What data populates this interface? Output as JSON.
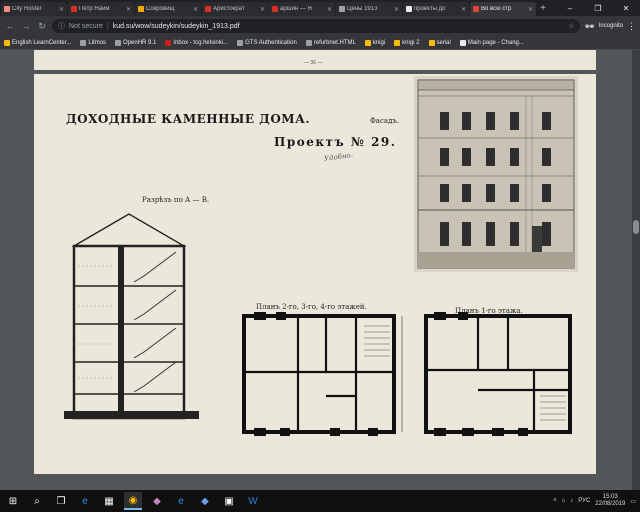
{
  "browser": {
    "tabs": [
      {
        "title": "City Roster",
        "color": "#f28b82",
        "active": false
      },
      {
        "title": "Пётр Наим",
        "color": "#d93025",
        "active": false
      },
      {
        "title": "Сокровищ",
        "color": "#f9ab00",
        "active": false
      },
      {
        "title": "Аристократ",
        "color": "#d93025",
        "active": false
      },
      {
        "title": "аршин — Я",
        "color": "#d93025",
        "active": false
      },
      {
        "title": "Цены 1913",
        "color": "#a0a0a0",
        "active": false
      },
      {
        "title": "проекты до",
        "color": "#e8eaed",
        "active": false
      },
      {
        "title": "Во всю стр",
        "color": "#ea4335",
        "active": true
      }
    ],
    "new_tab": "+",
    "window_controls": {
      "minimize": "–",
      "maximize": "❐",
      "close": "✕"
    },
    "nav": {
      "back": "←",
      "forward": "→",
      "reload": "↻"
    },
    "security_text": "Not secure",
    "url": "kud.su/wow/sudeykin/sudeykin_1913.pdf",
    "incognito_label": "Incognito",
    "star": "☆"
  },
  "bookmarks": [
    {
      "label": "English LearnCenter...",
      "color": "#fbbc04"
    },
    {
      "label": "Litmos",
      "color": "#9aa0a6"
    },
    {
      "label": "OpenHR 9.1",
      "color": "#9aa0a6"
    },
    {
      "label": "Inbox - tcg.helsinki...",
      "color": "#c5221f"
    },
    {
      "label": "GTS Authentication",
      "color": "#9aa0a6"
    },
    {
      "label": "refurbnet.HTML",
      "color": "#9aa0a6"
    },
    {
      "label": "knigi",
      "color": "#fbbc04"
    },
    {
      "label": "knigi 2",
      "color": "#fbbc04"
    },
    {
      "label": "serial",
      "color": "#fbbc04"
    },
    {
      "label": "Main page - Chang...",
      "color": "#e8eaed"
    }
  ],
  "document": {
    "page_number": "— 36 —",
    "title": "ДОХОДНЫЕ КАМЕННЫЕ ДОМА.",
    "project": "Проектъ № 29.",
    "handwritten": "Удобно.",
    "facade_label": "Фасадъ.",
    "section_label": "Разрѣзъ по А — В.",
    "plan_upper_label": "Планъ 2-го, 3-го, 4-го этажей.",
    "plan_ground_label": "Планъ 1-го этажа."
  },
  "taskbar": {
    "start": "⊞",
    "search": "⌕",
    "apps": [
      "task-view",
      "edge",
      "calculator",
      "chrome",
      "visual-studio",
      "edge-dev",
      "visual-studio-2",
      "app",
      "word"
    ],
    "language": "РУС",
    "time": "15:03",
    "date": "22/08/2019"
  }
}
